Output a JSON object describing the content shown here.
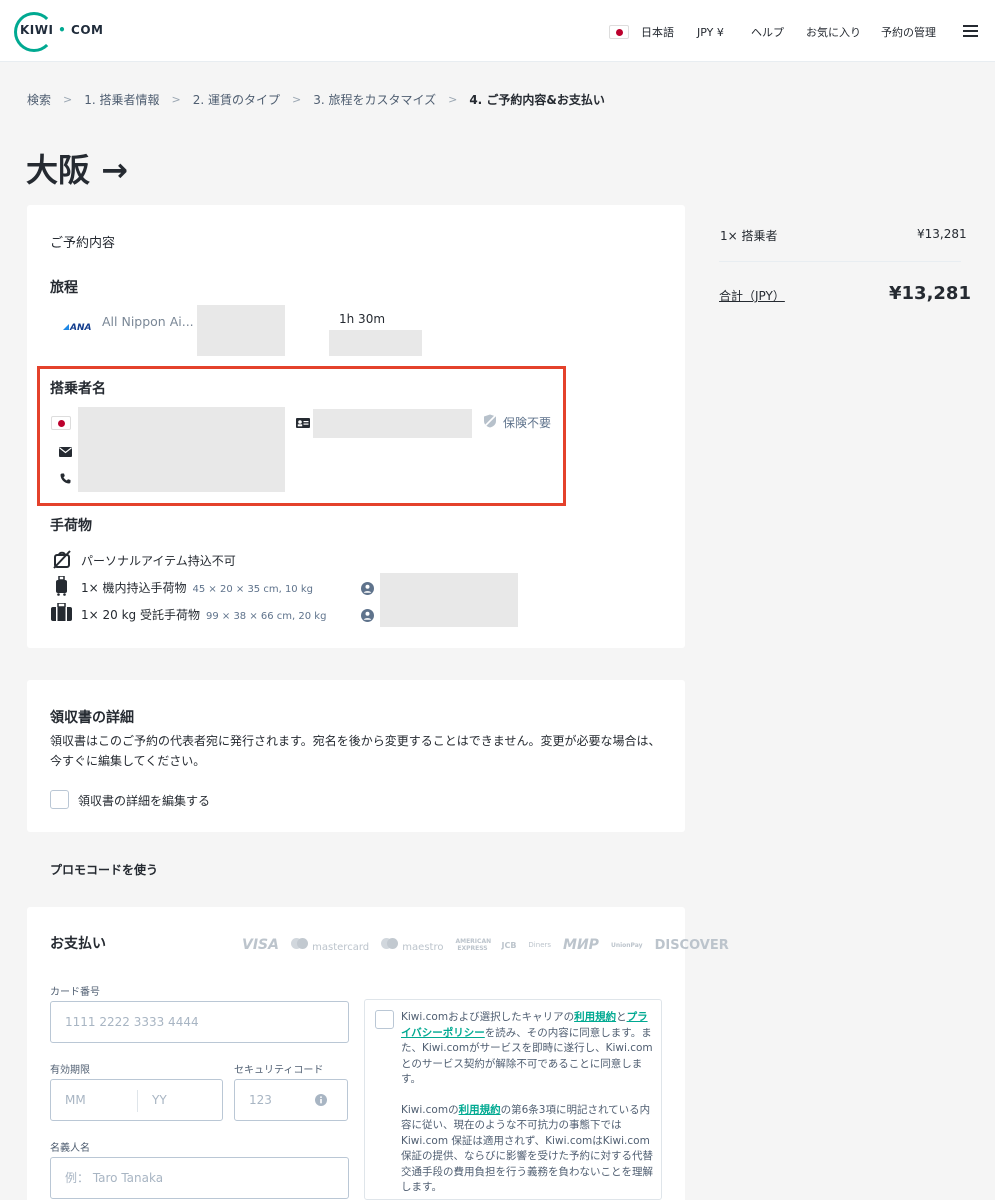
{
  "header": {
    "logo": "KIWI",
    "logo_dot": "•",
    "logo_suffix": "COM",
    "language": "日本語",
    "currency": "JPY ¥",
    "help": "ヘルプ",
    "favorites": "お気に入り",
    "manage_booking": "予約の管理"
  },
  "breadcrumb": {
    "items": [
      "検索",
      "1. 搭乗者情報",
      "2. 運賃のタイプ",
      "3. 旅程をカスタマイズ",
      "4. ご予約内容&お支払い"
    ],
    "separator": ">"
  },
  "page_title": "大阪 →",
  "booking": {
    "title": "ご予約内容",
    "itinerary_title": "旅程",
    "airline_logo": "ANA",
    "airline": "All Nippon Ai...",
    "duration": "1h 30m",
    "passenger_title": "搭乗者名",
    "insurance": "保険不要",
    "baggage_title": "手荷物",
    "baggage": [
      {
        "label": "パーソナルアイテム持込不可",
        "note": ""
      },
      {
        "label": "1× 機内持込手荷物",
        "note": "45 × 20 × 35 cm, 10 kg"
      },
      {
        "label": "1× 20 kg 受託手荷物",
        "note": "99 × 38 × 66 cm, 20 kg"
      }
    ]
  },
  "receipt": {
    "title": "領収書の詳細",
    "description": "領収書はこのご予約の代表者宛に発行されます。宛名を後から変更することはできません。変更が必要な場合は、今すぐに編集してください。",
    "edit_label": "領収書の詳細を編集する"
  },
  "promo": {
    "label": "プロモコードを使う"
  },
  "payment": {
    "title": "お支払い",
    "card_brands": [
      "VISA",
      "mastercard",
      "maestro",
      "AMERICAN EXPRESS",
      "JCB",
      "Diners",
      "МИР",
      "UnionPay",
      "DISCOVER"
    ],
    "card_number_label": "カード番号",
    "card_number_placeholder": "1111 2222 3333 4444",
    "expiry_label": "有効期限",
    "mm_placeholder": "MM",
    "yy_placeholder": "YY",
    "cvc_label": "セキュリティコード",
    "cvc_placeholder": "123",
    "holder_label": "名義人名",
    "holder_placeholder": "例： Taro Tanaka",
    "terms_p1_a": "Kiwi.comおよび選択したキャリアの",
    "terms_p1_link1": "利用規約",
    "terms_p1_b": "と",
    "terms_p1_link2": "プライバシーポリシー",
    "terms_p1_c": "を読み、その内容に同意します。また、Kiwi.comがサービスを即時に遂行し、Kiwi.comとのサービス契約が解除不可であることに同意します。",
    "terms_p2_a": "Kiwi.comの",
    "terms_p2_link": "利用規約",
    "terms_p2_b": "の第6条3項に明記されている内容に従い、現在のような不可抗力の事態下ではKiwi.com 保証は適用されず、Kiwi.comはKiwi.com 保証の提供、ならびに影響を受けた予約に対する代替交通手段の費用負担を行う義務を負わないことを理解します。"
  },
  "summary": {
    "passenger_label": "1× 搭乗者",
    "passenger_price": "¥13,281",
    "total_label": "合計（JPY）",
    "total_price": "¥13,281"
  },
  "colors": {
    "accent": "#00a991",
    "highlight": "#e4412b",
    "text": "#252a31",
    "muted": "#5f738c"
  }
}
